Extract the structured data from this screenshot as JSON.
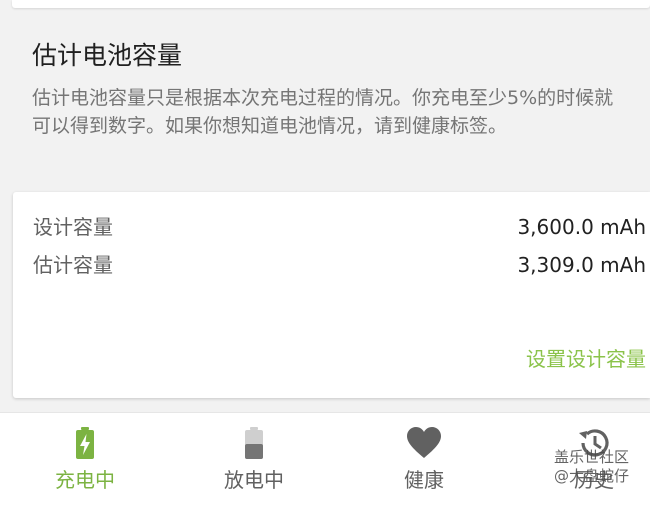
{
  "section": {
    "title": "估计电池容量",
    "description": "估计电池容量只是根据本次充电过程的情况。你充电至少5%的时候就可以得到数字。如果你想知道电池情况，请到健康标签。"
  },
  "capacity_card": {
    "design_label": "设计容量",
    "design_value": "3,600.0 mAh",
    "estimated_label": "估计容量",
    "estimated_value": "3,309.0 mAh",
    "set_capacity_label": "设置设计容量"
  },
  "bottom_nav": {
    "items": [
      {
        "label": "充电中",
        "icon": "battery-charging-icon",
        "active": true
      },
      {
        "label": "放电中",
        "icon": "battery-discharging-icon",
        "active": false
      },
      {
        "label": "健康",
        "icon": "heart-icon",
        "active": false
      },
      {
        "label": "历史",
        "icon": "history-icon",
        "active": false
      }
    ]
  },
  "watermark": {
    "line1": "盖乐世社区",
    "line2": "@大盘蛇仔"
  },
  "colors": {
    "accent": "#8bc34a",
    "text_primary": "#212121",
    "text_secondary": "#757575",
    "icon_inactive": "#616161"
  }
}
